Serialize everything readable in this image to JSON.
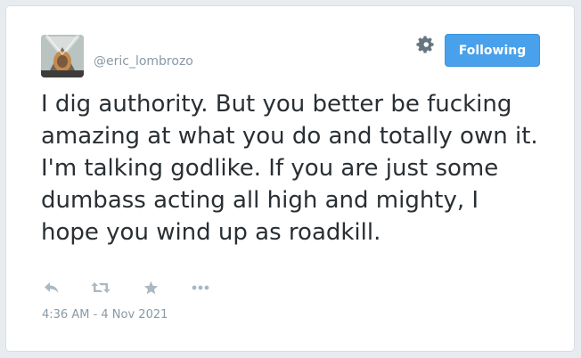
{
  "tweet": {
    "handle": "@eric_lombrozo",
    "text": "I dig authority. But you better be fucking amazing at what you do and totally own it. I'm talking godlike. If you are just some dumbass acting all high and mighty, I hope you wind up as roadkill.",
    "timestamp": "4:36 AM - 4 Nov 2021"
  },
  "header": {
    "follow_label": "Following"
  },
  "actions": {
    "icons": [
      "reply-icon",
      "retweet-icon",
      "favorite-icon",
      "more-icon"
    ]
  },
  "colors": {
    "accent": "#4aa1eb",
    "text": "#292f33",
    "muted": "#8899a6",
    "icon": "#aab8c2"
  }
}
